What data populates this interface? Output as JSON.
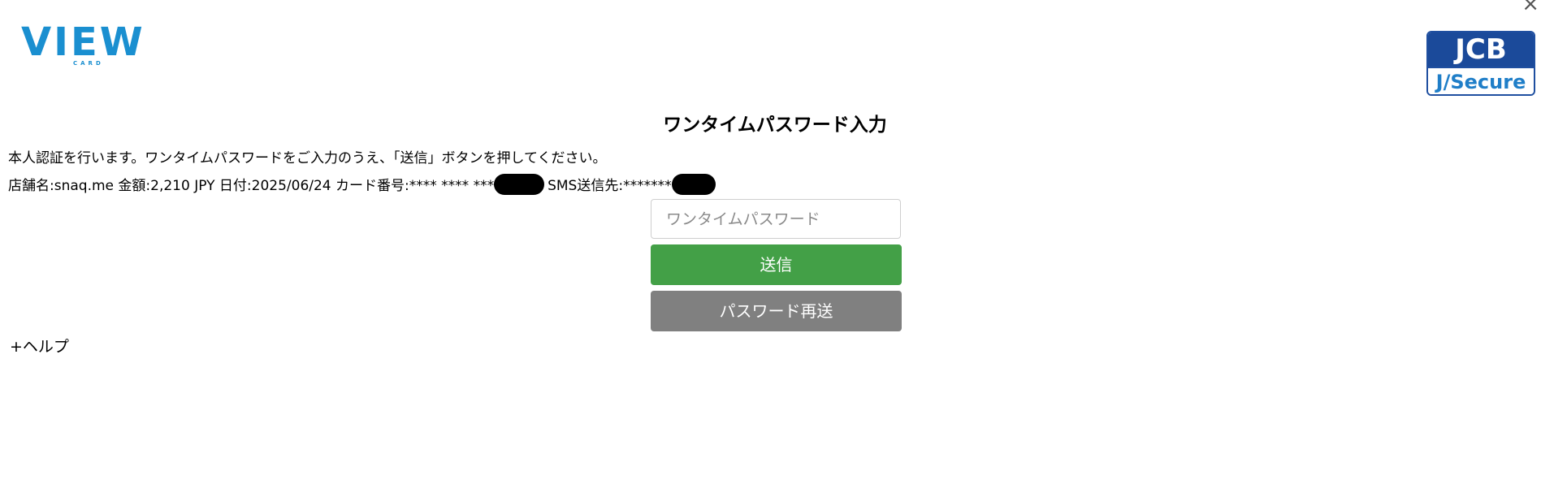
{
  "header": {
    "logo_left": {
      "text": "VIEW",
      "subtext": "CARD",
      "color": "#1a8fd0"
    },
    "logo_right": {
      "top": "JCB",
      "bottom": "J/Secure",
      "color": "#1b4a9a"
    },
    "close_icon": "×"
  },
  "main": {
    "title": "ワンタイムパスワード入力",
    "instruction": "本人認証を行います。ワンタイムパスワードをご入力のうえ、「送信」ボタンを押してください。",
    "details": {
      "shop_label": "店舗名:",
      "shop_value": "snaq.me",
      "amount_label": "金額:",
      "amount_value": "2,210 JPY",
      "date_label": "日付:",
      "date_value": "2025/06/24",
      "card_label": "カード番号:",
      "card_value": "**** **** ***",
      "sms_label": "SMS送信先:",
      "sms_value": "*******"
    },
    "otp_placeholder": "ワンタイムパスワード",
    "submit_label": "送信",
    "resend_label": "パスワード再送",
    "help_label": "+ヘルプ"
  },
  "colors": {
    "submit_button": "#43a047",
    "resend_button": "#808080"
  }
}
